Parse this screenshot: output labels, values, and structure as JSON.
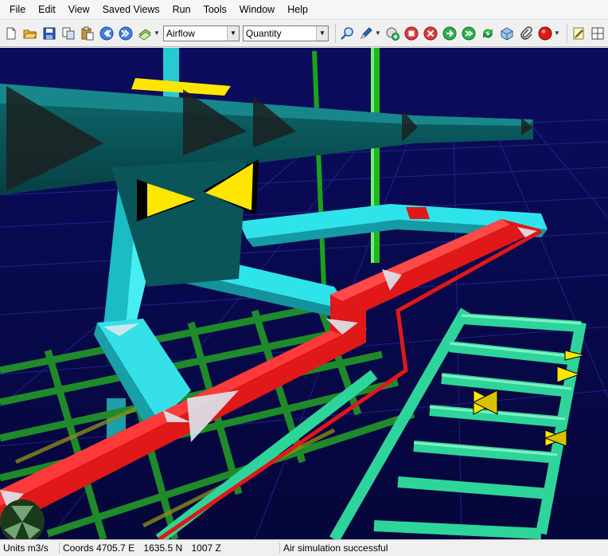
{
  "menu": [
    "File",
    "Edit",
    "View",
    "Saved Views",
    "Run",
    "Tools",
    "Window",
    "Help"
  ],
  "toolbar": {
    "mode_select": "Airflow",
    "field_select": "Quantity"
  },
  "statusbar": {
    "units_label": "Units",
    "units_value": "m3/s",
    "coords_label": "Coords",
    "coord_e": "4705.7 E",
    "coord_n": "1635.5 N",
    "coord_z": "1007 Z",
    "message": "Air simulation successful"
  },
  "colors": {
    "viewport_bg": "#0a0b55",
    "duct_dark": "#0e5e62",
    "duct_cyan": "#2fe3ea",
    "path_red": "#e01818",
    "mesh_green": "#1f8a2a",
    "mesh_mint": "#2ed59a",
    "fan_yellow": "#ffe600"
  }
}
